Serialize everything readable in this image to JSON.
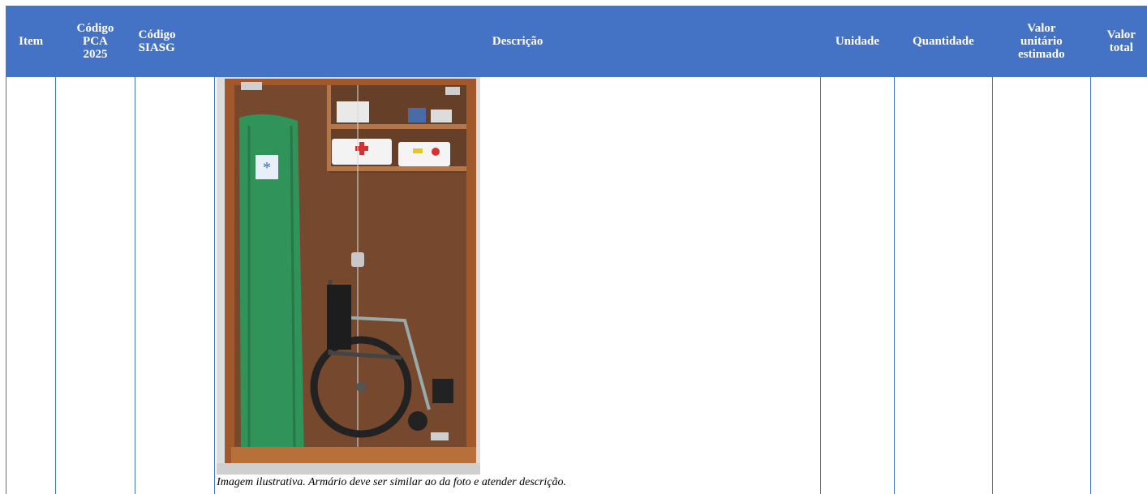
{
  "table": {
    "headers": {
      "item": "Item",
      "pca_line1": "Código",
      "pca_line2": "PCA",
      "pca_line3": "2025",
      "siasg_line1": "Código",
      "siasg_line2": "SIASG",
      "descricao": "Descrição",
      "unidade": "Unidade",
      "quantidade": "Quantidade",
      "vu_line1": "Valor",
      "vu_line2": "unitário",
      "vu_line3": "estimado",
      "vt_line1": "Valor",
      "vt_line2": "total"
    },
    "row": {
      "image_caption": "Imagem ilustrativa. Armário deve ser similar ao da foto e atender descrição."
    }
  },
  "colors": {
    "header_bg": "#4472c4",
    "header_text": "#ffffff"
  }
}
